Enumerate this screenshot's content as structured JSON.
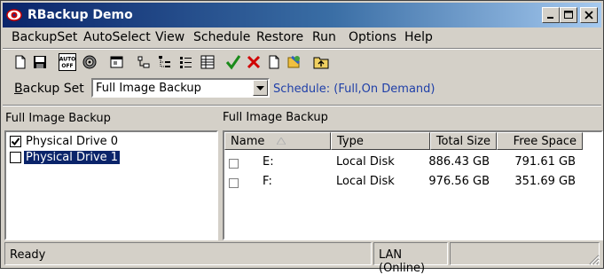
{
  "window": {
    "title": "RBackup Demo",
    "icon": "rbackup-eye-icon"
  },
  "menu": [
    "BackupSet",
    "AutoSelect",
    "View",
    "Schedule",
    "Restore",
    "Run",
    "Options",
    "Help"
  ],
  "toolbar": {
    "buttons": [
      "new-icon",
      "save-icon",
      "auto-off-icon",
      "gear-icon",
      "properties-icon",
      "tree-view-icon",
      "tree-expand-icon",
      "list-view-icon",
      "details-view-icon",
      "check-icon",
      "delete-icon",
      "document-icon",
      "restore-icon",
      "up-folder-icon"
    ],
    "auto_off_top": "AUTO",
    "auto_off_bottom": "OFF"
  },
  "backup_set": {
    "label_underlined": "B",
    "label_rest": "ackup Set",
    "value": "Full Image Backup",
    "schedule": "Schedule: (Full,On Demand)"
  },
  "left_pane": {
    "title": "Full Image Backup",
    "items": [
      {
        "label": "Physical Drive 0",
        "checked": true,
        "selected": false
      },
      {
        "label": "Physical Drive 1",
        "checked": false,
        "selected": true
      }
    ]
  },
  "right_pane": {
    "title": "Full Image Backup",
    "columns": [
      "Name",
      "Type",
      "Total Size",
      "Free Space"
    ],
    "rows": [
      {
        "name": "E:",
        "type": "Local Disk",
        "total": "886.43 GB",
        "free": "791.61 GB"
      },
      {
        "name": "F:",
        "type": "Local Disk",
        "total": "976.56 GB",
        "free": "351.69 GB"
      }
    ]
  },
  "status": {
    "left": "Ready",
    "connection": "LAN (Online)"
  },
  "colors": {
    "title_gradient_start": "#0a246a",
    "title_gradient_end": "#a6caf0",
    "schedule_text": "#1f3fa8",
    "selection": "#0a246a"
  }
}
